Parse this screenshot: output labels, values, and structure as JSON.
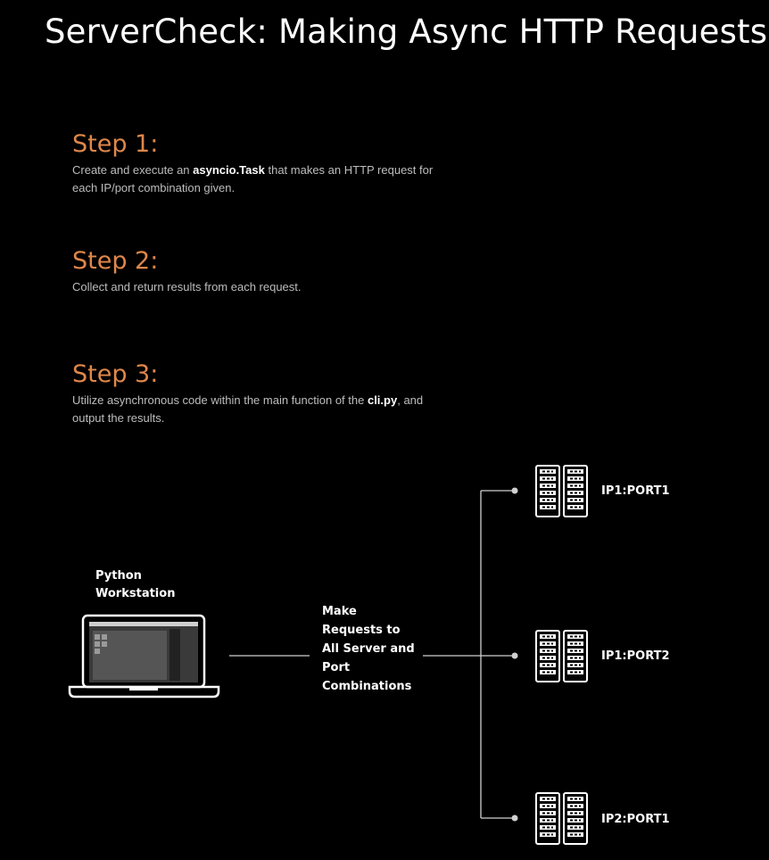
{
  "title": "ServerCheck: Making Async HTTP Requests",
  "steps": [
    {
      "title": "Step 1:",
      "desc_before": "Create and execute an ",
      "desc_bold": "asyncio.Task",
      "desc_after": " that makes an HTTP request for each IP/port combination given."
    },
    {
      "title": "Step 2:",
      "desc": "Collect and return results from each request."
    },
    {
      "title": "Step 3:",
      "desc_before": "Utilize asynchronous code within the main function of the ",
      "desc_bold": "cli.py",
      "desc_after": ", and output the results."
    }
  ],
  "diagram": {
    "workstation_label_line1": "Python",
    "workstation_label_line2": "Workstation",
    "connector_label_lines": [
      "Make",
      "Requests to",
      "All Server and",
      "Port",
      "Combinations"
    ],
    "servers": [
      {
        "label": "IP1:PORT1"
      },
      {
        "label": "IP1:PORT2"
      },
      {
        "label": "IP2:PORT1"
      }
    ],
    "accent_color": "#e0874a"
  }
}
